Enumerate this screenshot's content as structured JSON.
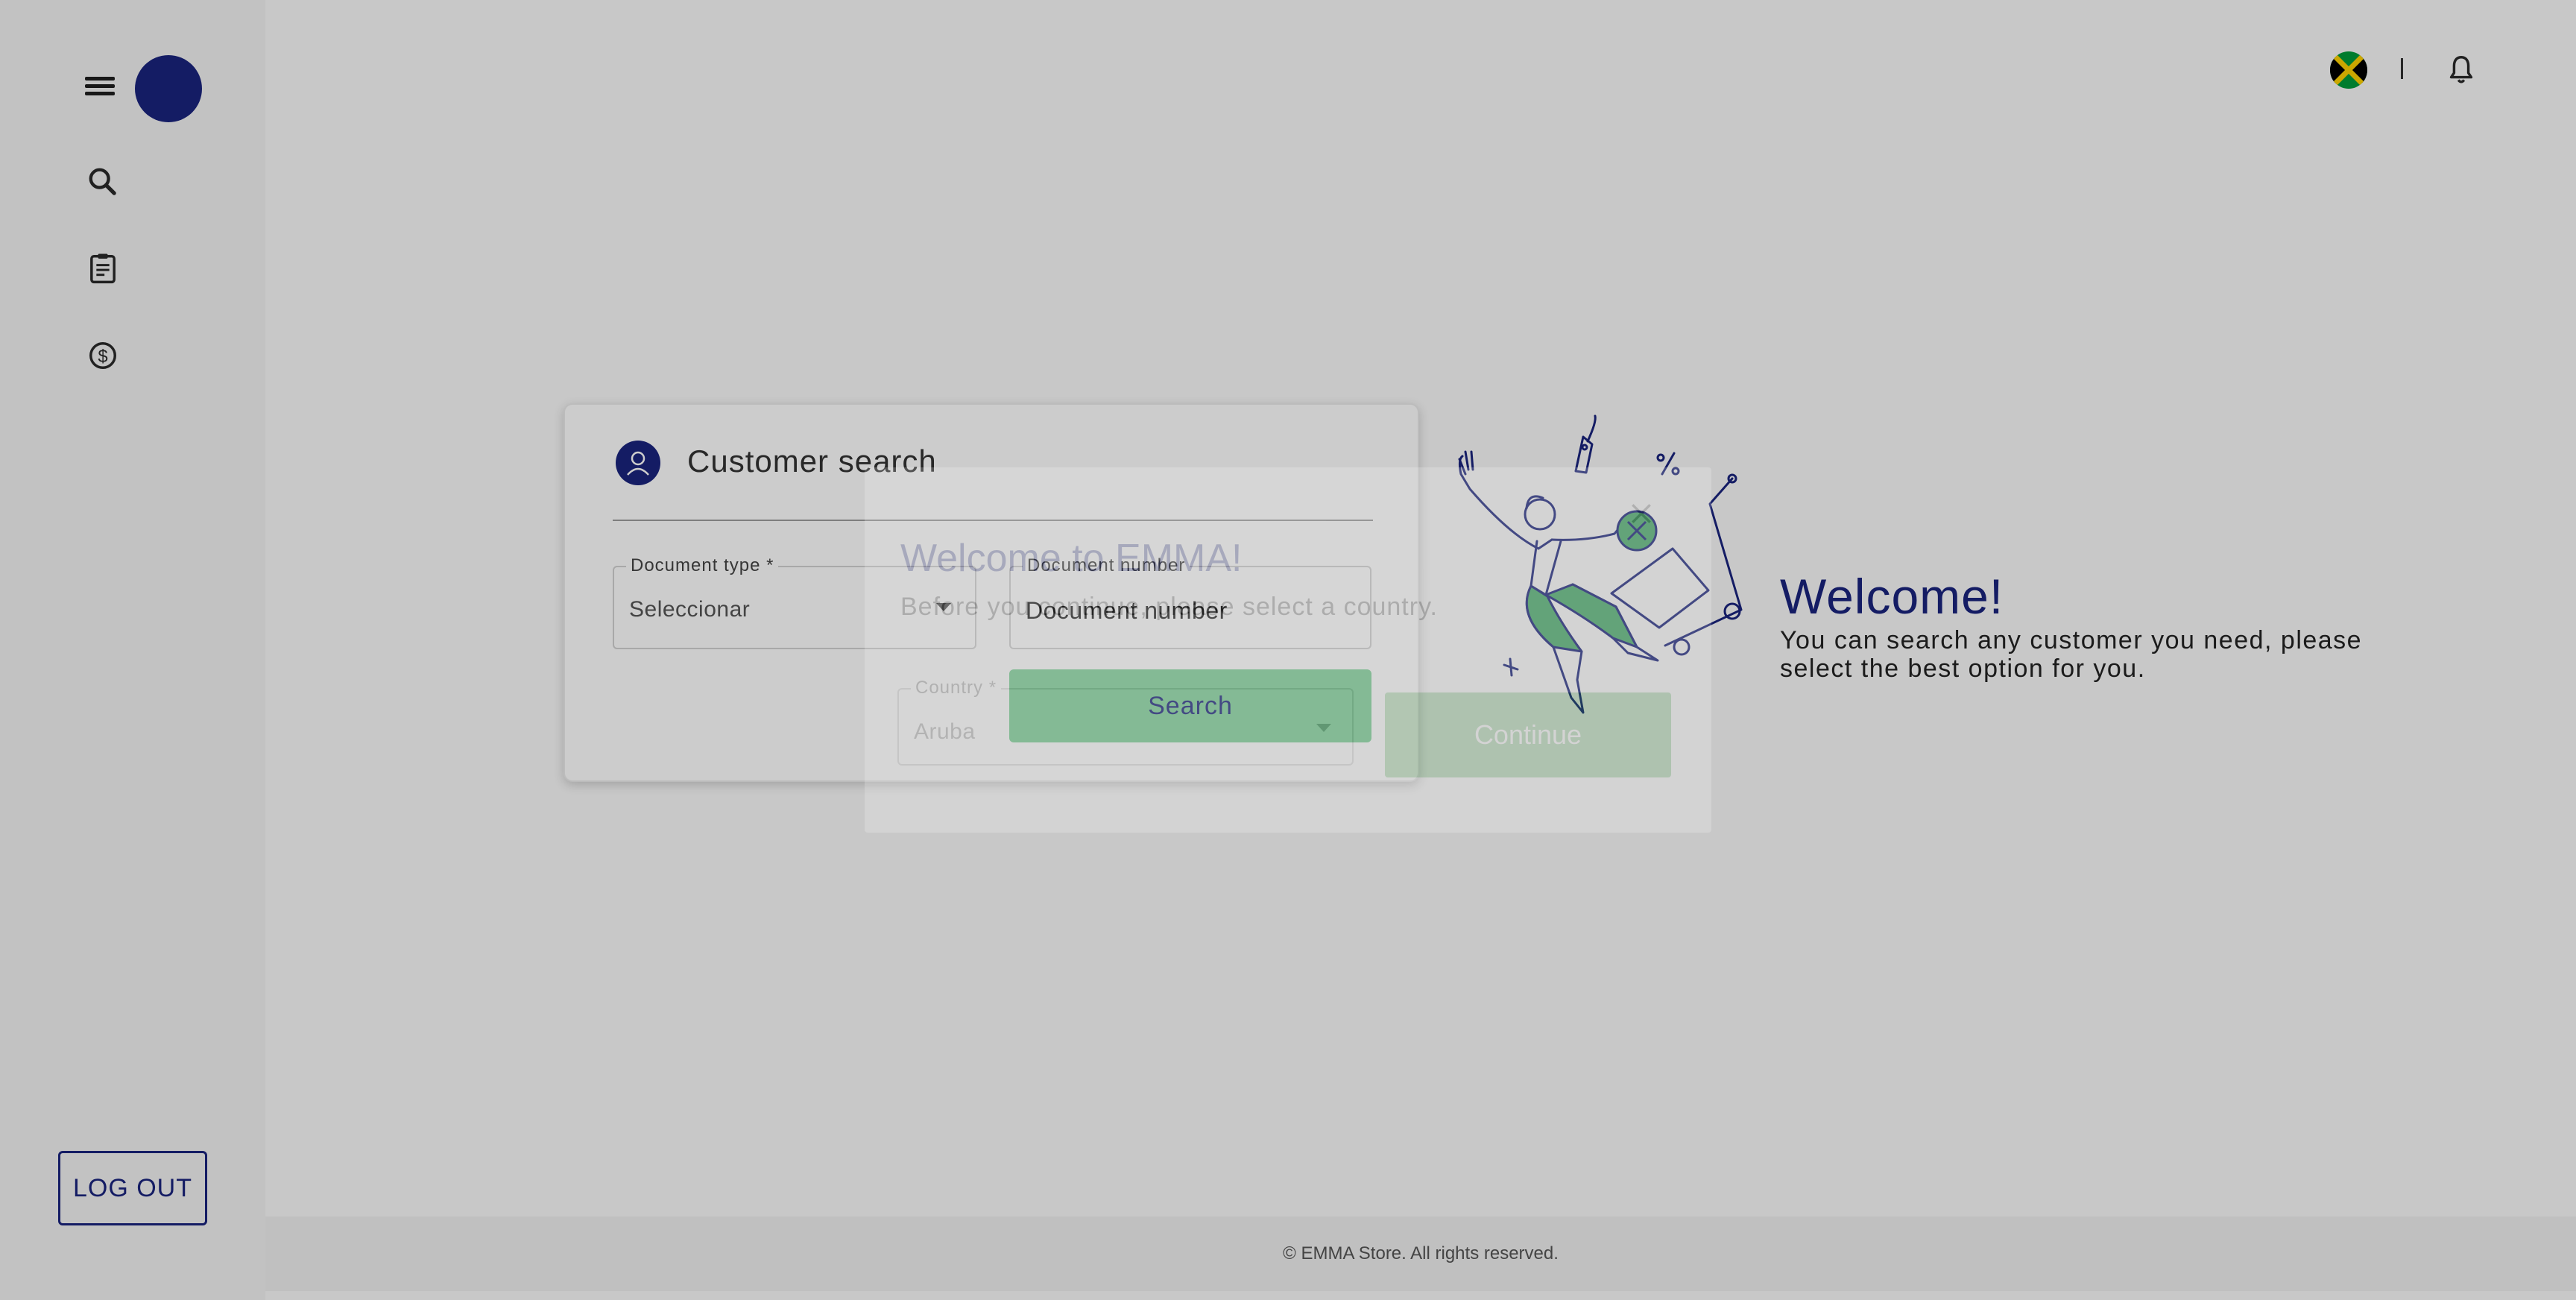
{
  "sidebar": {
    "nav": [
      {
        "icon": "search-icon"
      },
      {
        "icon": "clipboard-icon"
      },
      {
        "icon": "dollar-icon"
      }
    ],
    "logout_label": "LOG OUT"
  },
  "topbar": {
    "flag": "jamaica-flag-icon",
    "bell": "bell-icon"
  },
  "search_card": {
    "title": "Customer search",
    "document_type": {
      "label": "Document type *",
      "value": "Seleccionar"
    },
    "document_number": {
      "label": "Document number",
      "placeholder": "Document number"
    },
    "search_label": "Search"
  },
  "welcome": {
    "title": "Welcome!",
    "text": "You can search any customer you need, please select the best option for you."
  },
  "modal": {
    "title": "Welcome to EMMA!",
    "subtitle": "Before you continue, please select a country.",
    "country": {
      "label": "Country *",
      "value": "Aruba"
    },
    "continue_label": "Continue"
  },
  "footer": {
    "text": "© EMMA Store. All rights reserved."
  },
  "colors": {
    "brand": "#1a237e",
    "accent_green": "#7fd49a"
  }
}
